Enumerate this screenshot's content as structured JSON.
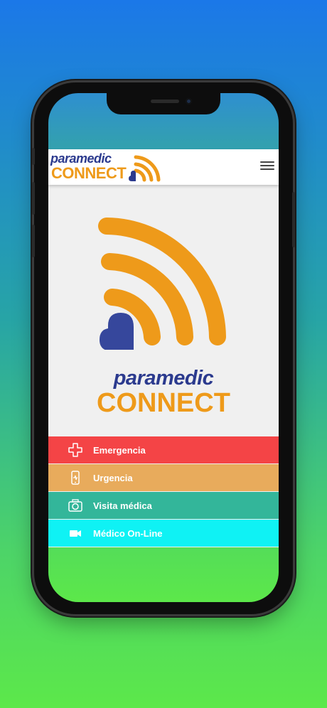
{
  "header": {
    "logo_line1": "paramedic",
    "logo_line2": "CONNECT"
  },
  "hero": {
    "brand_line1": "paramedic",
    "brand_line2": "CONNECT"
  },
  "menu": [
    {
      "label": "Emergencia",
      "icon": "medical-cross-icon",
      "color": "#f44446"
    },
    {
      "label": "Urgencia",
      "icon": "phone-pulse-icon",
      "color": "#e8ab5c"
    },
    {
      "label": "Visita médica",
      "icon": "camera-icon",
      "color": "#33b69a"
    },
    {
      "label": "Médico On-Line",
      "icon": "video-camera-icon",
      "color": "#0ff2f4"
    }
  ],
  "colors": {
    "brand_blue": "#2b3a8e",
    "brand_orange": "#ee9a1a"
  }
}
